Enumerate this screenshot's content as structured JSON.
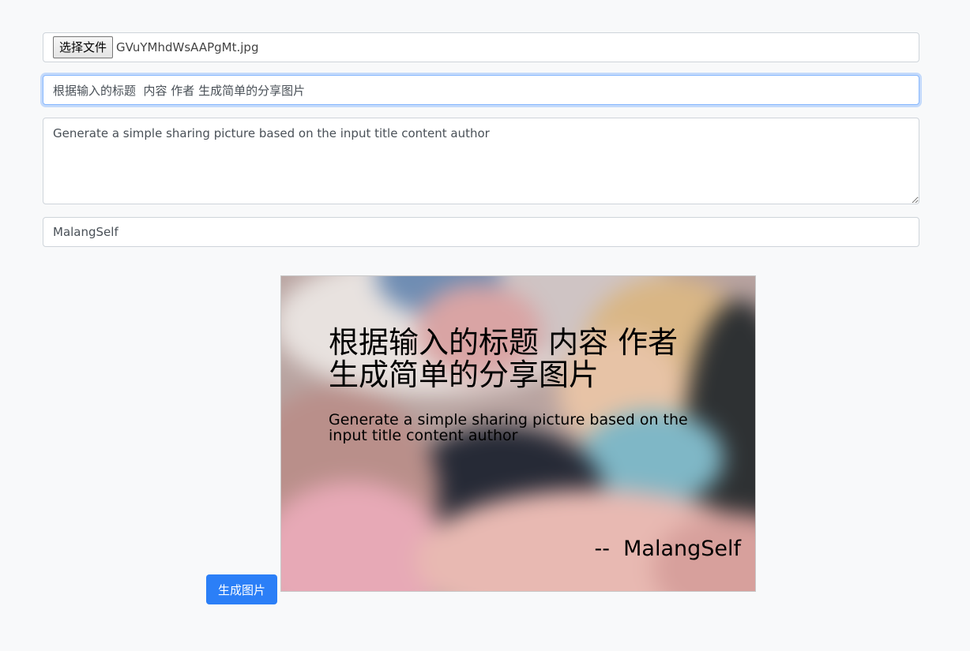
{
  "file_input": {
    "button_label": "选择文件",
    "file_name": "GVuYMhdWsAAPgMt.jpg"
  },
  "title_input": {
    "value": "根据输入的标题  内容 作者 生成简单的分享图片"
  },
  "content_textarea": {
    "value": "Generate a simple sharing picture based on the input title content author"
  },
  "author_input": {
    "value": "MalangSelf"
  },
  "preview": {
    "title": "根据输入的标题  内容 作者 生成简单的分享图片",
    "content": "Generate a simple sharing picture based on the input title content author",
    "author": "--  MalangSelf"
  },
  "generate_button": {
    "label": "生成图片"
  },
  "colors": {
    "page_background": "#f8f9fa",
    "primary_button": "#2b7ff7",
    "focus_border": "#86b7fe"
  }
}
